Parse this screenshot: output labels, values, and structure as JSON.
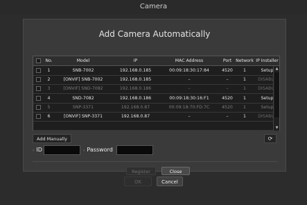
{
  "window": {
    "title": "Camera"
  },
  "dialog": {
    "title": "Add Camera Automatically",
    "columns": [
      "No.",
      "Model",
      "IP",
      "MAC Address",
      "Port",
      "Network",
      "IP Installer"
    ],
    "rows": [
      {
        "no": "1",
        "model": "SNB-7002",
        "ip": "192.168.0.185",
        "mac": "00:09:18:30:17:84",
        "port": "4520",
        "network": "1",
        "installer": "Setup",
        "dim": false
      },
      {
        "no": "2",
        "model": "[ONVIF] SNB-7002",
        "ip": "192.168.0.185",
        "mac": "–",
        "port": "–",
        "network": "1",
        "installer": "DISABLE",
        "dim": false
      },
      {
        "no": "3",
        "model": "[ONVIF] SND-7082",
        "ip": "192.168.0.186",
        "mac": "–",
        "port": "–",
        "network": "1",
        "installer": "DISABLE",
        "dim": true
      },
      {
        "no": "4",
        "model": "SND-7082",
        "ip": "192.168.0.186",
        "mac": "00:09:18:30:16:F1",
        "port": "4520",
        "network": "1",
        "installer": "Setup",
        "dim": false
      },
      {
        "no": "5",
        "model": "SNP-3371",
        "ip": "192.168.0.87",
        "mac": "00:09:18:70:FD:7C",
        "port": "4520",
        "network": "1",
        "installer": "Setup",
        "dim": true
      },
      {
        "no": "6",
        "model": "[ONVIF] SNP-3371",
        "ip": "192.168.0.87",
        "mac": "–",
        "port": "–",
        "network": "1",
        "installer": "DISABLE",
        "dim": false
      }
    ],
    "add_manually_label": "Add Manually",
    "id_label": "ID",
    "id_value": "",
    "password_label": "Password",
    "password_value": "",
    "register_label": "Register",
    "close_label": "Close"
  },
  "footer": {
    "ok_label": "OK",
    "cancel_label": "Cancel"
  },
  "icons": {
    "refresh": "refresh-icon",
    "scroll_up": "arrow-up-icon",
    "scroll_down": "arrow-down-icon",
    "checkbox": "checkbox-icon"
  },
  "colors": {
    "background": "#2c2c2c",
    "dialog": "#3a3a3a",
    "table": "#1e1e1e",
    "close_button": "#4a4a4a"
  }
}
